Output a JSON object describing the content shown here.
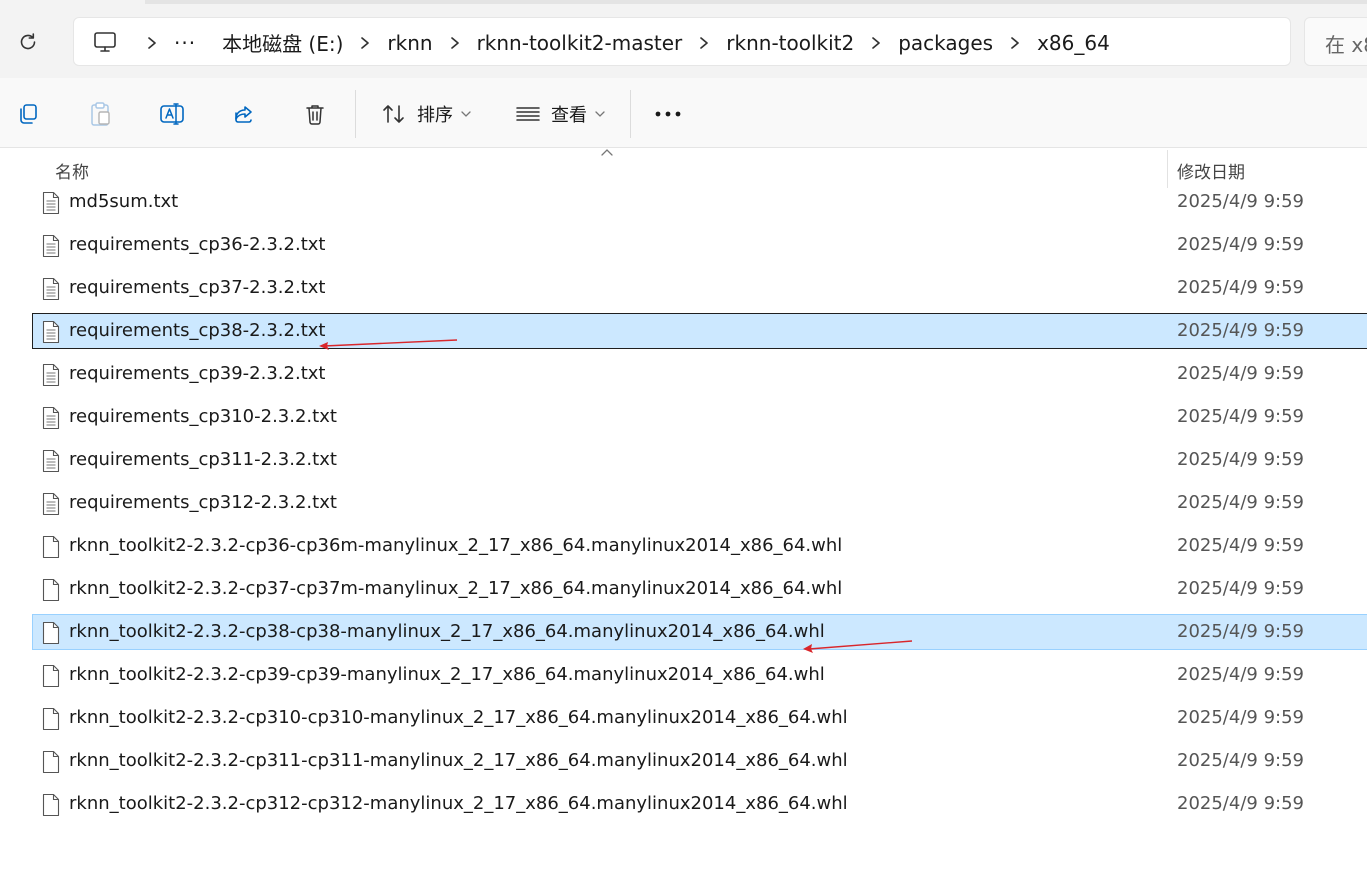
{
  "address_bar": {
    "more_label": "···",
    "crumbs": [
      "本地磁盘 (E:)",
      "rknn",
      "rknn-toolkit2-master",
      "rknn-toolkit2",
      "packages",
      "x86_64"
    ]
  },
  "search": {
    "text": "在 x8"
  },
  "toolbar": {
    "sort_label": "排序",
    "view_label": "查看"
  },
  "columns": {
    "name": "名称",
    "date_modified": "修改日期"
  },
  "files": [
    {
      "name": "md5sum.txt",
      "date": "2025/4/9 9:59"
    },
    {
      "name": "requirements_cp36-2.3.2.txt",
      "date": "2025/4/9 9:59"
    },
    {
      "name": "requirements_cp37-2.3.2.txt",
      "date": "2025/4/9 9:59"
    },
    {
      "name": "requirements_cp38-2.3.2.txt",
      "date": "2025/4/9 9:59"
    },
    {
      "name": "requirements_cp39-2.3.2.txt",
      "date": "2025/4/9 9:59"
    },
    {
      "name": "requirements_cp310-2.3.2.txt",
      "date": "2025/4/9 9:59"
    },
    {
      "name": "requirements_cp311-2.3.2.txt",
      "date": "2025/4/9 9:59"
    },
    {
      "name": "requirements_cp312-2.3.2.txt",
      "date": "2025/4/9 9:59"
    },
    {
      "name": "rknn_toolkit2-2.3.2-cp36-cp36m-manylinux_2_17_x86_64.manylinux2014_x86_64.whl",
      "date": "2025/4/9 9:59"
    },
    {
      "name": "rknn_toolkit2-2.3.2-cp37-cp37m-manylinux_2_17_x86_64.manylinux2014_x86_64.whl",
      "date": "2025/4/9 9:59"
    },
    {
      "name": "rknn_toolkit2-2.3.2-cp38-cp38-manylinux_2_17_x86_64.manylinux2014_x86_64.whl",
      "date": "2025/4/9 9:59"
    },
    {
      "name": "rknn_toolkit2-2.3.2-cp39-cp39-manylinux_2_17_x86_64.manylinux2014_x86_64.whl",
      "date": "2025/4/9 9:59"
    },
    {
      "name": "rknn_toolkit2-2.3.2-cp310-cp310-manylinux_2_17_x86_64.manylinux2014_x86_64.whl",
      "date": "2025/4/9 9:59"
    },
    {
      "name": "rknn_toolkit2-2.3.2-cp311-cp311-manylinux_2_17_x86_64.manylinux2014_x86_64.whl",
      "date": "2025/4/9 9:59"
    },
    {
      "name": "rknn_toolkit2-2.3.2-cp312-cp312-manylinux_2_17_x86_64.manylinux2014_x86_64.whl",
      "date": "2025/4/9 9:59"
    }
  ],
  "colors": {
    "selection": "#cce8ff",
    "annotation_arrow": "#d9262b",
    "accent": "#005fb8"
  }
}
